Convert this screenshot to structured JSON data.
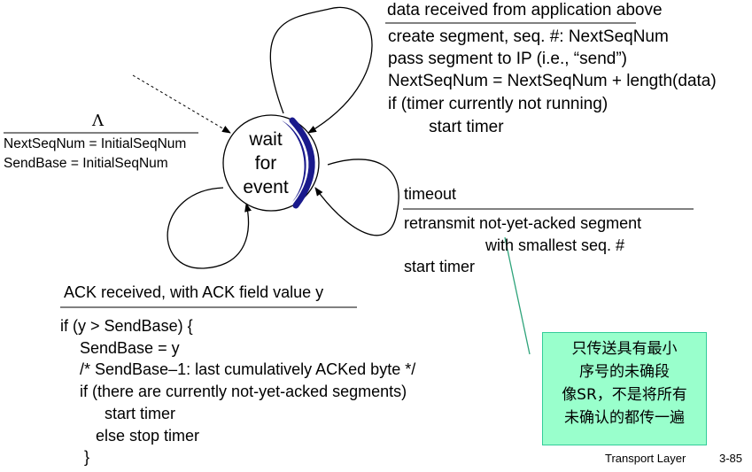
{
  "state": {
    "lines": [
      "wait",
      "for",
      "event"
    ]
  },
  "top_transition": {
    "event": "data received from application above",
    "actions": [
      "create segment, seq. #: NextSeqNum",
      "pass segment to IP (i.e., “send”)",
      "NextSeqNum = NextSeqNum + length(data)",
      "if (timer currently not running)",
      "    start timer"
    ]
  },
  "init_transition": {
    "event": "Λ",
    "actions": [
      "NextSeqNum = InitialSeqNum",
      "SendBase = InitialSeqNum"
    ]
  },
  "timeout_transition": {
    "event": "timeout",
    "actions": [
      "retransmit not-yet-acked segment",
      "with smallest seq. #",
      "start timer"
    ]
  },
  "ack_transition": {
    "event": "ACK received, with ACK field value y",
    "actions": [
      "if (y > SendBase) {",
      "SendBase = y",
      "/* SendBase–1: last cumulatively ACKed byte */",
      "if (there are currently not-yet-acked segments)",
      "start timer",
      "else stop timer",
      "}"
    ]
  },
  "callout": {
    "lines": [
      "只传送具有最小",
      "序号的未确段",
      "像SR，不是将所有",
      "未确认的都传一遍"
    ]
  },
  "footer": {
    "label": "Transport Layer",
    "page": "3-85"
  },
  "colors": {
    "state_shadow": "#1a1a8c",
    "callout_fill": "#99ffcc",
    "callout_border": "#33cc99",
    "pointer_line": "#2ea37a"
  }
}
